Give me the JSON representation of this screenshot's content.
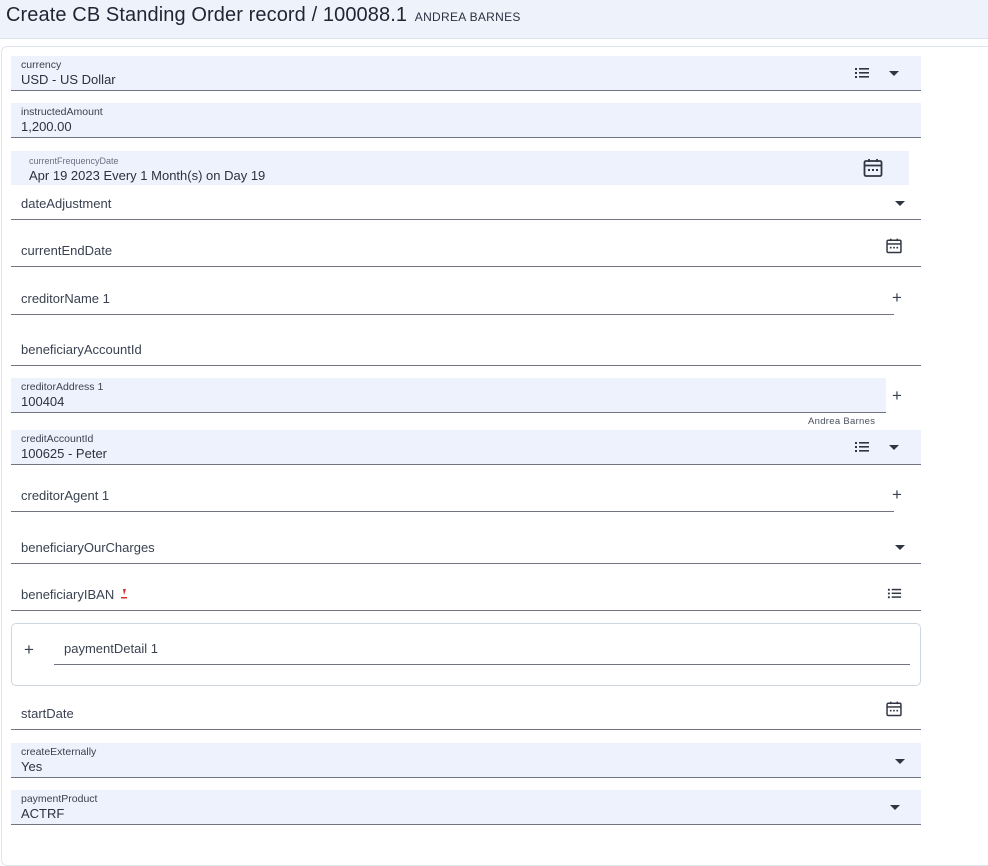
{
  "header": {
    "title": "Create CB Standing Order record / 100088.1",
    "subtitle": "ANDREA BARNES"
  },
  "fields": {
    "currency": {
      "label": "currency",
      "value": "USD - US Dollar"
    },
    "instructedAmount": {
      "label": "instructedAmount",
      "value": "1,200.00"
    },
    "currentFrequencyDate": {
      "label": "currentFrequencyDate",
      "value": "Apr 19 2023 Every 1 Month(s) on Day 19"
    },
    "dateAdjustment": {
      "label": "dateAdjustment"
    },
    "currentEndDate": {
      "label": "currentEndDate"
    },
    "creditorName": {
      "label": "creditorName 1"
    },
    "beneficiaryAccountId": {
      "label": "beneficiaryAccountId"
    },
    "creditorAddress": {
      "label": "creditorAddress 1",
      "value": "100404",
      "hint": "Andrea Barnes"
    },
    "creditAccountId": {
      "label": "creditAccountId",
      "value": "100625 - Peter"
    },
    "creditorAgent": {
      "label": "creditorAgent 1"
    },
    "beneficiaryOurCharges": {
      "label": "beneficiaryOurCharges"
    },
    "beneficiaryIBAN": {
      "label": "beneficiaryIBAN"
    },
    "paymentDetail": {
      "label": "paymentDetail 1"
    },
    "startDate": {
      "label": "startDate"
    },
    "createExternally": {
      "label": "createExternally",
      "value": "Yes"
    },
    "paymentProduct": {
      "label": "paymentProduct",
      "value": "ACTRF"
    }
  },
  "icons": {
    "list": "list-icon",
    "calendar": "calendar-icon",
    "dropdown": "chevron-down-icon",
    "add": "plus-icon",
    "required": "required-marker-icon"
  },
  "colors": {
    "header_bg": "#eef3fb",
    "field_bg": "#edf2fc",
    "required_marker": "#d93025"
  }
}
